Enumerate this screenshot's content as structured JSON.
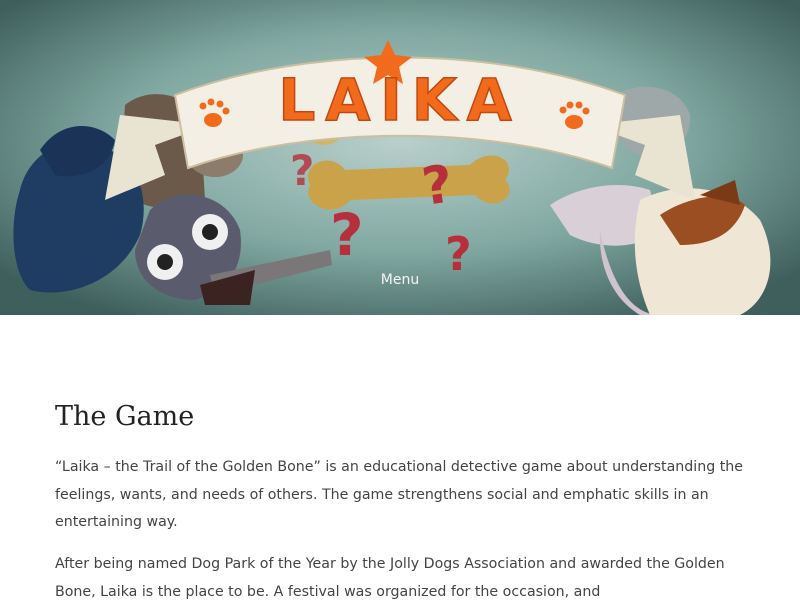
{
  "hero": {
    "logo_text": "LAIKA",
    "menu_label": "Menu",
    "colors": {
      "background": "#6f9a94",
      "banner": "#f3efe4",
      "logo": "#f26b1d",
      "bone": "#c9a24a",
      "question_marks": "#b5303c"
    }
  },
  "section": {
    "title": "The Game",
    "paragraphs": [
      "“Laika – the Trail of the Golden Bone” is an educational detective game about understanding the feelings, wants, and needs of others. The game strengthens social and emphatic skills in an entertaining way.",
      "After being named Dog Park of the Year by the Jolly Dogs Association and awarded the Golden Bone, Laika is the place to be. A festival was organized for the occasion, and"
    ]
  }
}
